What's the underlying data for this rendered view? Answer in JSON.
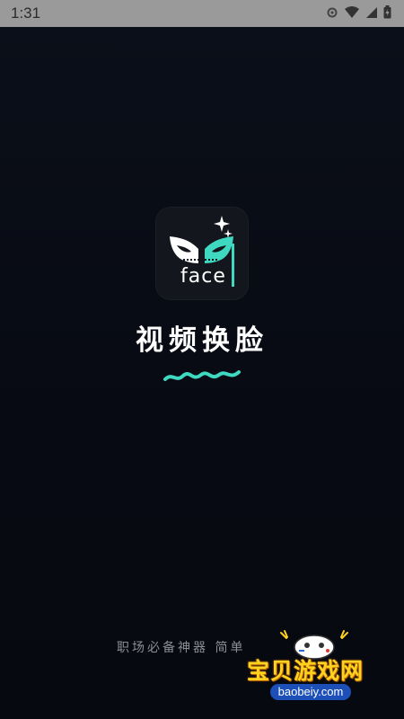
{
  "status_bar": {
    "time": "1:31",
    "icons": [
      "settings-gear-icon",
      "wifi-icon",
      "signal-icon",
      "battery-icon"
    ]
  },
  "splash": {
    "icon": {
      "name": "face-mask-icon",
      "word": "face"
    },
    "title": "视频换脸",
    "tagline": "职场必备神器  简单"
  },
  "watermark": {
    "title": "宝贝游戏网",
    "url": "baobeiy.com"
  },
  "colors": {
    "background": "#080b13",
    "accent": "#3fd8c1",
    "watermark_yellow": "#ffd21f",
    "watermark_blue": "#1c4fb8"
  }
}
